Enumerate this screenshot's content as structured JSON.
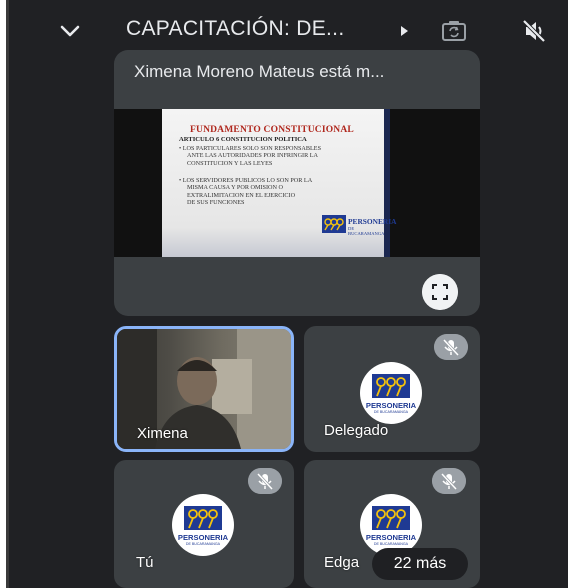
{
  "header": {
    "meeting_title": "CAPACITACIÓN: DE...",
    "icons": {
      "collapse": "chevron-down-icon",
      "details": "play-triangle-icon",
      "switch_camera": "camera-flip-icon",
      "audio": "speaker-off-icon"
    }
  },
  "presentation": {
    "presenter_label": "Ximena Moreno Mateus está m...",
    "slide": {
      "heading": "FUNDAMENTO CONSTITUCIONAL",
      "subheading": "ARTICULO 6 CONSTITUCION POLITICA",
      "bullet1": [
        "• LOS PARTICULARES SOLO SON RESPONSABLES",
        "ANTE LAS AUTORIDADES POR INFRINGIR LA",
        "CONSTITUCION Y LAS LEYES"
      ],
      "bullet2": [
        "• LOS SERVIDORES PUBLICOS LO SON POR LA",
        "MISMA CAUSA Y POR OMISION O",
        "EXTRALIMITACION EN EL EJERCICIO",
        "DE SUS FUNCIONES"
      ],
      "logo_name": "PERSONERIA",
      "logo_sub": "DE BUCARAMANGA"
    },
    "fullscreen_icon": "fullscreen-icon"
  },
  "participants": [
    {
      "name": "Ximena",
      "active_speaker": true,
      "video_on": true
    },
    {
      "name": "Delegado",
      "muted": true,
      "avatar_text": "PERSONERIA",
      "avatar_sub": "DE BUCARAMANGA"
    },
    {
      "name": "Tú",
      "muted": true,
      "avatar_text": "PERSONERIA",
      "avatar_sub": "DE BUCARAMANGA"
    },
    {
      "name": "Edga",
      "muted": true,
      "avatar_text": "PERSONERIA",
      "avatar_sub": "DE BUCARAMANGA"
    }
  ],
  "more_participants": "22 más",
  "colors": {
    "background": "#202124",
    "tile": "#3c4043",
    "active_border": "#8ab4f8",
    "brand_blue": "#1f3a93",
    "brand_yellow": "#f4c20d"
  }
}
